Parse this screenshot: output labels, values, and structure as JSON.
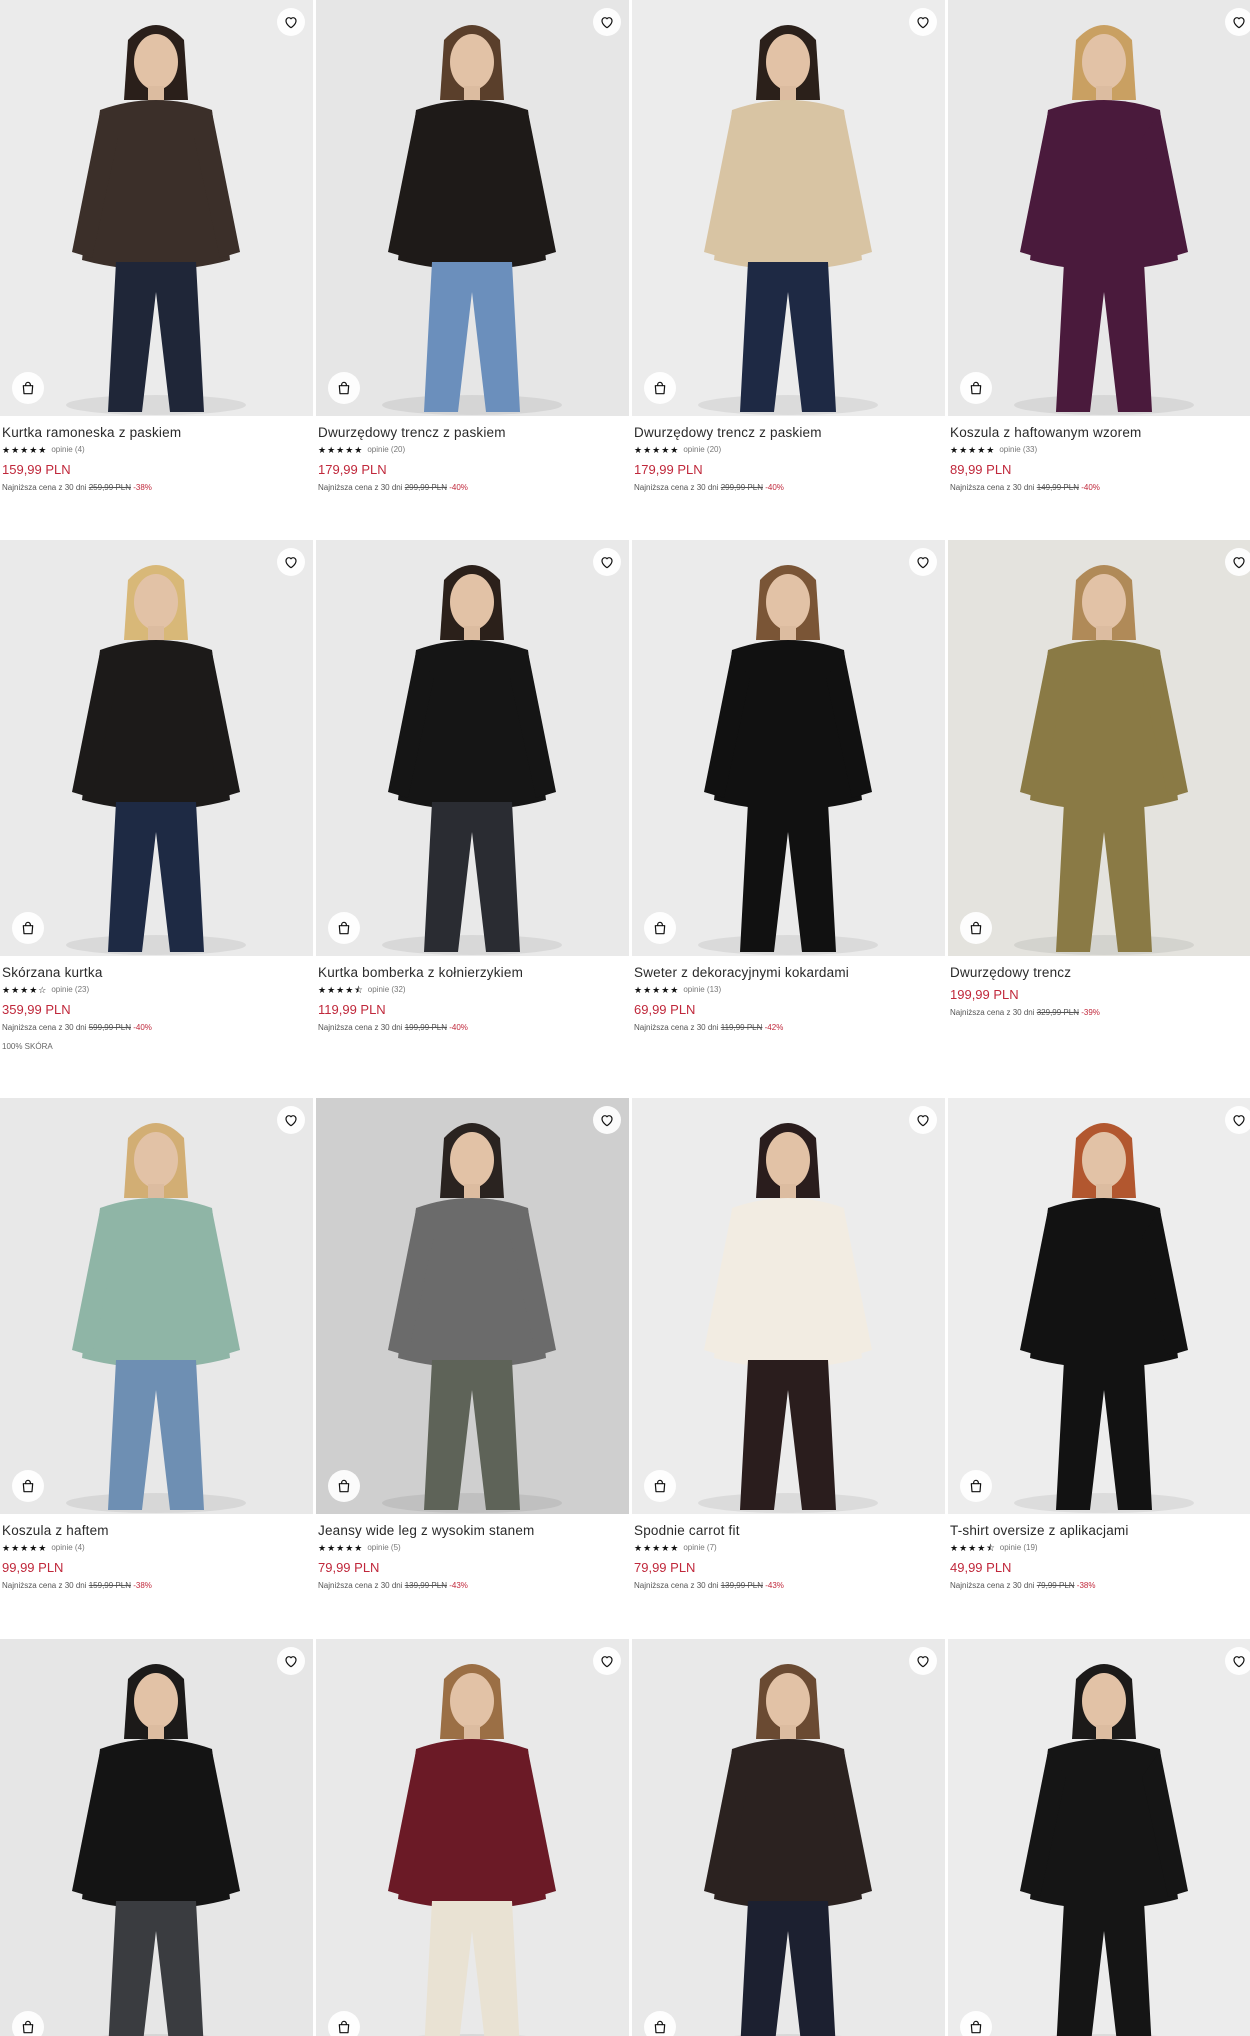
{
  "products": [
    {
      "name": "Kurtka ramoneska z paskiem",
      "rating": 5,
      "stars": "★★★★★",
      "reviews": "opinie (4)",
      "price": "159,99 PLN",
      "lowest_label": "Najniższa cena z 30 dni",
      "old_price": "259,99 PLN",
      "discount": "-38%",
      "bg": "#ebebeb",
      "garment": "#3b2f29",
      "bottom": "#1f2638",
      "hair": "#2a1f1a"
    },
    {
      "name": "Dwurzędowy trencz z paskiem",
      "rating": 5,
      "stars": "★★★★★",
      "reviews": "opinie (20)",
      "price": "179,99 PLN",
      "lowest_label": "Najniższa cena z 30 dni",
      "old_price": "299,99 PLN",
      "discount": "-40%",
      "bg": "#e6e6e6",
      "garment": "#1e1a18",
      "bottom": "#6b8fbc",
      "hair": "#5a3f2b"
    },
    {
      "name": "Dwurzędowy trencz z paskiem",
      "rating": 5,
      "stars": "★★★★★",
      "reviews": "opinie (20)",
      "price": "179,99 PLN",
      "lowest_label": "Najniższa cena z 30 dni",
      "old_price": "299,99 PLN",
      "discount": "-40%",
      "bg": "#ececec",
      "garment": "#d8c4a3",
      "bottom": "#1e2944",
      "hair": "#2b201a"
    },
    {
      "name": "Koszula z haftowanym wzorem",
      "rating": 5,
      "stars": "★★★★★",
      "reviews": "opinie (33)",
      "price": "89,99 PLN",
      "lowest_label": "Najniższa cena z 30 dni",
      "old_price": "149,99 PLN",
      "discount": "-40%",
      "bg": "#e8e8e8",
      "garment": "#4a1a3c",
      "bottom": "#4a1a3c",
      "hair": "#c9a062"
    },
    {
      "name": "Skórzana kurtka",
      "rating": 4,
      "stars": "★★★★☆",
      "reviews": "opinie (23)",
      "price": "359,99 PLN",
      "lowest_label": "Najniższa cena z 30 dni",
      "old_price": "599,99 PLN",
      "discount": "-40%",
      "extra": "100% SKÓRA",
      "bg": "#eaeaea",
      "garment": "#1c1a19",
      "bottom": "#1e2a44",
      "hair": "#d8b878"
    },
    {
      "name": "Kurtka bomberka z kołnierzykiem",
      "rating": 4.5,
      "stars": "★★★★⯪",
      "reviews": "opinie (32)",
      "price": "119,99 PLN",
      "lowest_label": "Najniższa cena z 30 dni",
      "old_price": "199,99 PLN",
      "discount": "-40%",
      "bg": "#e9e9e9",
      "garment": "#151515",
      "bottom": "#2a2c32",
      "hair": "#2b201a"
    },
    {
      "name": "Sweter z dekoracyjnymi kokardami",
      "rating": 5,
      "stars": "★★★★★",
      "reviews": "opinie (13)",
      "price": "69,99 PLN",
      "lowest_label": "Najniższa cena z 30 dni",
      "old_price": "119,99 PLN",
      "discount": "-42%",
      "bg": "#ebebeb",
      "garment": "#111111",
      "bottom": "#111111",
      "hair": "#7a5536"
    },
    {
      "name": "Dwurzędowy trencz",
      "price": "199,99 PLN",
      "lowest_label": "Najniższa cena z 30 dni",
      "old_price": "329,99 PLN",
      "discount": "-39%",
      "bg": "#e4e3de",
      "garment": "#8a7a45",
      "bottom": "#8a7a45",
      "hair": "#b08a58"
    },
    {
      "name": "Koszula z haftem",
      "rating": 5,
      "stars": "★★★★★",
      "reviews": "opinie (4)",
      "price": "99,99 PLN",
      "lowest_label": "Najniższa cena z 30 dni",
      "old_price": "159,99 PLN",
      "discount": "-38%",
      "bg": "#e8e8e8",
      "garment": "#8fb5a6",
      "bottom": "#6e8fb3",
      "hair": "#d2ae74"
    },
    {
      "name": "Jeansy wide leg z wysokim stanem",
      "rating": 5,
      "stars": "★★★★★",
      "reviews": "opinie (5)",
      "price": "79,99 PLN",
      "lowest_label": "Najniższa cena z 30 dni",
      "old_price": "139,99 PLN",
      "discount": "-43%",
      "bg": "#cfcfcf",
      "garment": "#6b6b6b",
      "bottom": "#5e6358",
      "hair": "#2a2320"
    },
    {
      "name": "Spodnie carrot fit",
      "rating": 5,
      "stars": "★★★★★",
      "reviews": "opinie (7)",
      "price": "79,99 PLN",
      "lowest_label": "Najniższa cena z 30 dni",
      "old_price": "139,99 PLN",
      "discount": "-43%",
      "bg": "#ececec",
      "garment": "#f2ece2",
      "bottom": "#2a1d1d",
      "hair": "#2a1d1d"
    },
    {
      "name": "T-shirt oversize z aplikacjami",
      "rating": 4.5,
      "stars": "★★★★⯪",
      "reviews": "opinie (19)",
      "price": "49,99 PLN",
      "lowest_label": "Najniższa cena z 30 dni",
      "old_price": "79,99 PLN",
      "discount": "-38%",
      "bg": "#ededed",
      "garment": "#121212",
      "bottom": "#121212",
      "hair": "#b2572f"
    },
    {
      "name": "",
      "bg": "#e6e6e6",
      "garment": "#141414",
      "bottom": "#3a3c40",
      "hair": "#1c1a19"
    },
    {
      "name": "",
      "bg": "#e9e9e9",
      "garment": "#6b1a26",
      "bottom": "#e9e2d3",
      "hair": "#9b6f45"
    },
    {
      "name": "",
      "bg": "#e9e9e9",
      "garment": "#2b2220",
      "bottom": "#1c2030",
      "hair": "#6a4a32"
    },
    {
      "name": "",
      "bg": "#ececec",
      "garment": "#151515",
      "bottom": "#151515",
      "hair": "#1c1a19"
    }
  ]
}
